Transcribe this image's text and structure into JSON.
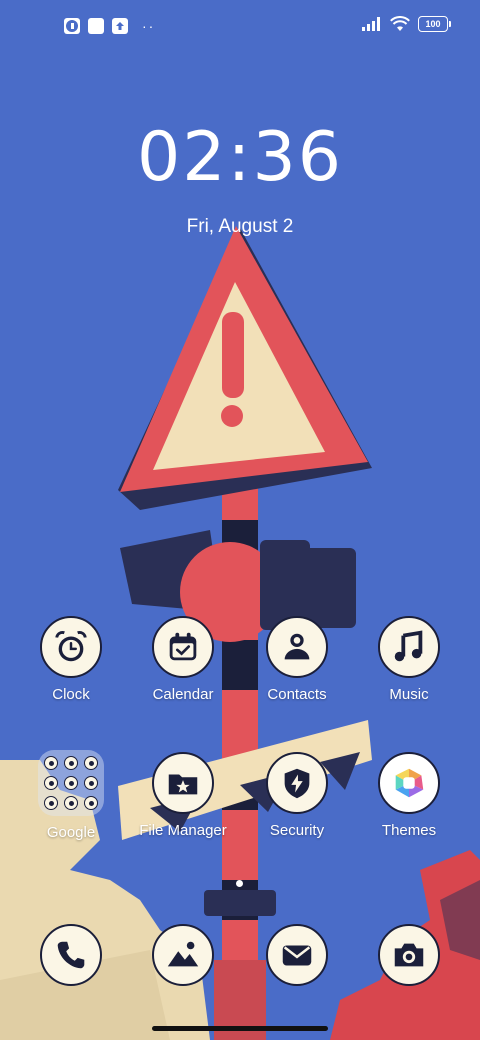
{
  "status_bar": {
    "notification_icons": [
      "app-notification-icon",
      "square-notification-icon",
      "upload-icon"
    ],
    "more_indicator": "··",
    "battery_level": "100",
    "signal": "cellular-signal-icon",
    "wifi": "wifi-icon"
  },
  "lock": {
    "time": "02:36",
    "date": "Fri, August 2"
  },
  "apps": {
    "clock": "Clock",
    "calendar": "Calendar",
    "contacts": "Contacts",
    "music": "Music",
    "google": "Google",
    "file_manager": "File Manager",
    "security": "Security",
    "themes": "Themes"
  },
  "dock": [
    "phone-icon",
    "gallery-icon",
    "messages-icon",
    "camera-icon"
  ],
  "colors": {
    "sky": "#4a6cc8",
    "icon_bg": "#fbf6e6",
    "icon_ink": "#1b1f3a",
    "sign_red": "#e2545a",
    "sign_cream": "#f2e0b8"
  }
}
